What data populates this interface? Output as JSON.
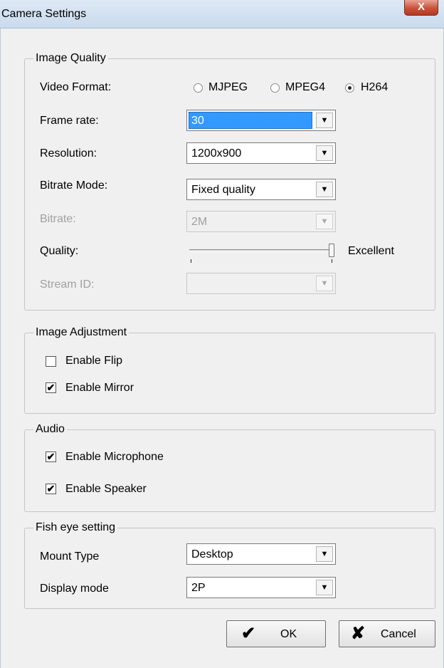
{
  "window": {
    "title": "Camera Settings",
    "close_glyph": "X"
  },
  "image_quality": {
    "legend": "Image Quality",
    "video_format": {
      "label": "Video Format:",
      "options": [
        "MJPEG",
        "MPEG4",
        "H264"
      ],
      "selected": "H264"
    },
    "frame_rate": {
      "label": "Frame rate:",
      "value": "30"
    },
    "resolution": {
      "label": "Resolution:",
      "value": "1200x900"
    },
    "bitrate_mode": {
      "label": "Bitrate Mode:",
      "value": "Fixed quality"
    },
    "bitrate": {
      "label": "Bitrate:",
      "value": "2M",
      "disabled": true
    },
    "quality": {
      "label": "Quality:",
      "value_label": "Excellent",
      "level": 1.0
    },
    "stream_id": {
      "label": "Stream ID:",
      "value": "",
      "disabled": true
    }
  },
  "image_adjustment": {
    "legend": "Image Adjustment",
    "flip": {
      "label": "Enable Flip",
      "checked": false
    },
    "mirror": {
      "label": "Enable Mirror",
      "checked": true
    }
  },
  "audio": {
    "legend": "Audio",
    "microphone": {
      "label": "Enable Microphone",
      "checked": true
    },
    "speaker": {
      "label": "Enable Speaker",
      "checked": true
    }
  },
  "fisheye": {
    "legend": "Fish eye setting",
    "mount_type": {
      "label": "Mount Type",
      "value": "Desktop"
    },
    "display_mode": {
      "label": "Display mode",
      "value": "2P"
    }
  },
  "buttons": {
    "ok": {
      "label": "OK",
      "icon": "check-icon",
      "glyph": "✔"
    },
    "cancel": {
      "label": "Cancel",
      "icon": "cross-icon",
      "glyph": "✘"
    }
  },
  "icons": {
    "dropdown_arrow": "▼",
    "check_mark": "✔"
  }
}
